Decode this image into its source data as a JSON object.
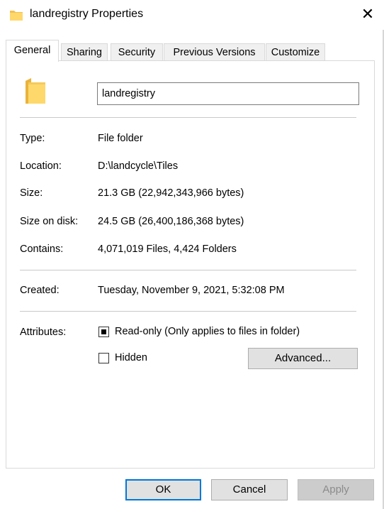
{
  "window": {
    "title": "landregistry Properties",
    "close_symbol": "✕",
    "icon": "folder-icon"
  },
  "tabs": [
    {
      "label": "General",
      "active": true
    },
    {
      "label": "Sharing",
      "active": false
    },
    {
      "label": "Security",
      "active": false
    },
    {
      "label": "Previous Versions",
      "active": false
    },
    {
      "label": "Customize",
      "active": false
    }
  ],
  "general": {
    "folder_name": "landregistry",
    "type_label": "Type:",
    "type_value": "File folder",
    "location_label": "Location:",
    "location_value": "D:\\landcycle\\Tiles",
    "size_label": "Size:",
    "size_value": "21.3 GB (22,942,343,966 bytes)",
    "size_on_disk_label": "Size on disk:",
    "size_on_disk_value": "24.5 GB (26,400,186,368 bytes)",
    "contains_label": "Contains:",
    "contains_value": "4,071,019 Files, 4,424 Folders",
    "created_label": "Created:",
    "created_value": "Tuesday, November 9, 2021, 5:32:08 PM",
    "attributes_label": "Attributes:",
    "readonly_label": "Read-only (Only applies to files in folder)",
    "readonly_state": "indeterminate",
    "hidden_label": "Hidden",
    "hidden_checked": false,
    "advanced_label": "Advanced..."
  },
  "buttons": {
    "ok": "OK",
    "cancel": "Cancel",
    "apply": "Apply",
    "apply_enabled": false
  },
  "colors": {
    "folder_yellow": "#FFD86B",
    "focus_blue": "#0078d7",
    "button_gray": "#e1e1e1"
  }
}
